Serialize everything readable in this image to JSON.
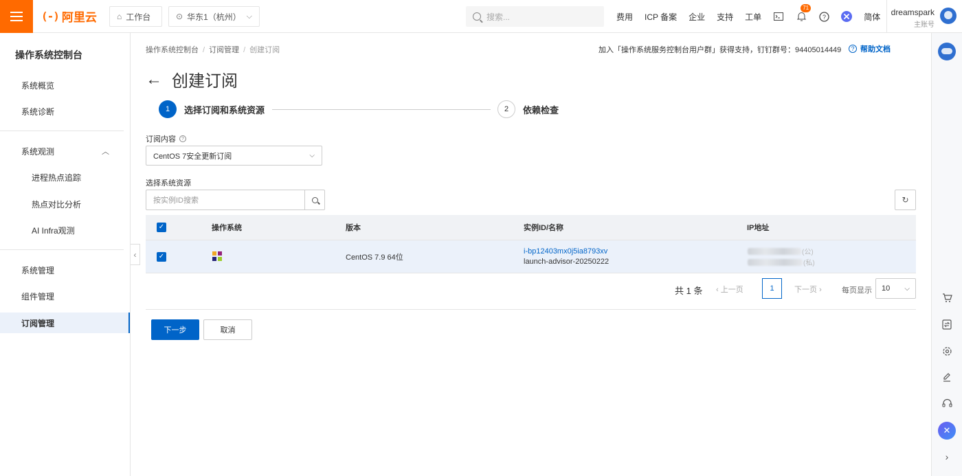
{
  "topbar": {
    "brand": "阿里云",
    "brand_mark": "(-)",
    "workbench": "工作台",
    "region": "华东1（杭州）",
    "search_placeholder": "搜索...",
    "links": [
      "费用",
      "ICP 备案",
      "企业",
      "支持",
      "工单"
    ],
    "notification_count": "71",
    "language": "简体",
    "username": "dreamspark",
    "account_type": "主账号",
    "accent_color": "#ff6a00"
  },
  "sidebar": {
    "title": "操作系统控制台",
    "items": [
      {
        "label": "系统概览"
      },
      {
        "label": "系统诊断"
      },
      {
        "label": "系统观测"
      },
      {
        "label": "进程热点追踪"
      },
      {
        "label": "热点对比分析"
      },
      {
        "label": "AI Infra观测"
      },
      {
        "label": "系统管理"
      },
      {
        "label": "组件管理"
      },
      {
        "label": "订阅管理"
      }
    ]
  },
  "breadcrumb": [
    "操作系统控制台",
    "订阅管理",
    "创建订阅"
  ],
  "help": {
    "note": "加入「操作系统服务控制台用户群」获得支持，钉钉群号：94405014449",
    "link": "帮助文档"
  },
  "page": {
    "title": "创建订阅",
    "steps": [
      {
        "num": "1",
        "label": "选择订阅和系统资源"
      },
      {
        "num": "2",
        "label": "依赖检查"
      }
    ],
    "subscription_label": "订阅内容",
    "subscription_value": "CentOS 7安全更新订阅",
    "resource_label": "选择系统资源",
    "instance_search_placeholder": "按实例ID搜索"
  },
  "table": {
    "headers": [
      "操作系统",
      "版本",
      "实例ID/名称",
      "IP地址"
    ],
    "rows": [
      {
        "os_icon": "centos-logo-icon",
        "version": "CentOS 7.9 64位",
        "instance_id": "i-bp12403mx0j5ia8793xv",
        "instance_name": "launch-advisor-20250222",
        "ip_public_suffix": "(公)",
        "ip_private_suffix": "(私)"
      }
    ]
  },
  "pagination": {
    "total": "共 1 条",
    "prev": "上一页",
    "page": "1",
    "next": "下一页",
    "page_size_label": "每页显示",
    "page_size": "10"
  },
  "actions": {
    "next": "下一步",
    "cancel": "取消"
  },
  "colors": {
    "primary": "#0064c8",
    "brand": "#ff6a00",
    "row_selected": "#ebf1fa"
  }
}
